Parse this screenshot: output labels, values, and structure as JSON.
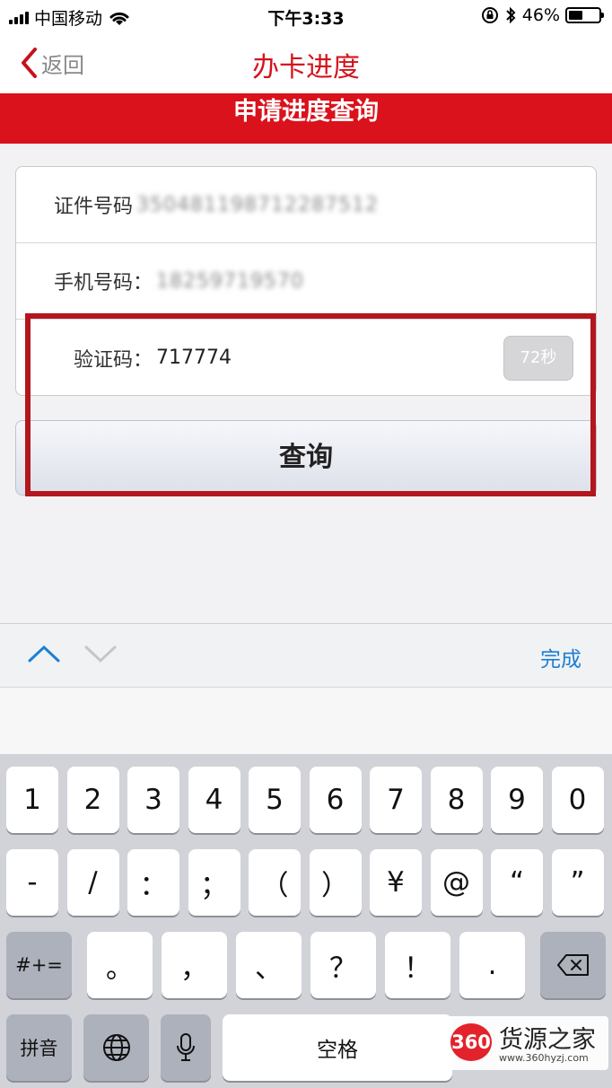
{
  "status_bar": {
    "carrier": "中国移动",
    "time": "下午3:33",
    "battery": "46%",
    "battery_level": 0.46
  },
  "nav": {
    "back_label": "返回",
    "title": "办卡进度"
  },
  "banner": {
    "title": "申请进度查询"
  },
  "form": {
    "id_label": "证件号码",
    "id_value": "350481198712287512",
    "phone_label": "手机号码：",
    "phone_value": "18259719570",
    "code_label": "验证码：",
    "code_value": "717774",
    "countdown": "72秒"
  },
  "query_button": "查询",
  "toolbar": {
    "done": "完成"
  },
  "keyboard": {
    "row1": [
      "1",
      "2",
      "3",
      "4",
      "5",
      "6",
      "7",
      "8",
      "9",
      "0"
    ],
    "row2": [
      "-",
      "/",
      "：",
      "；",
      "（",
      "）",
      "¥",
      "@",
      "“",
      "”"
    ],
    "row3_left": "#+=",
    "row3": [
      "。",
      "，",
      "、",
      "？",
      "！",
      "."
    ],
    "row4_left": "拼音",
    "space": "空格"
  },
  "watermark": {
    "badge": "360",
    "text": "货源之家",
    "url": "www.360hyzj.com"
  },
  "colors": {
    "brand_red": "#d9121c",
    "done_blue": "#1d7fd2"
  }
}
